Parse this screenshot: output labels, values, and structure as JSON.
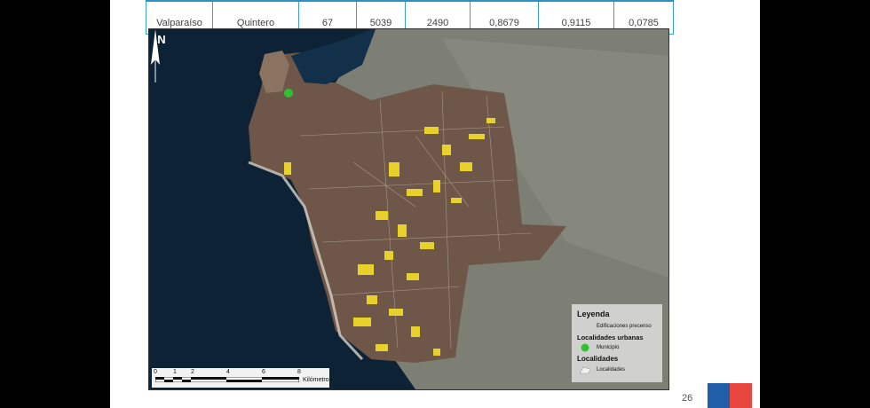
{
  "table": {
    "row": [
      "Valparaíso",
      "Quintero",
      "67",
      "5039",
      "2490",
      "0,8679",
      "0,9115",
      "0,0785"
    ]
  },
  "map": {
    "north_label": "N",
    "scale": {
      "ticks": [
        "0",
        "1",
        "2",
        "4",
        "6",
        "8"
      ],
      "unit": "Kilómetros"
    },
    "legend": {
      "title": "Leyenda",
      "item_buildings": "Edificaciones precenso",
      "section_urban": "Localidades urbanas",
      "item_municipio": "Municipio",
      "section_localidades": "Localidades",
      "item_localidades": "Localidades"
    },
    "colors": {
      "sea": "#0e2235",
      "land": "#6e5648",
      "buildings": "#e8d12a",
      "municipio": "#2ec22e"
    }
  },
  "page_number": "26"
}
